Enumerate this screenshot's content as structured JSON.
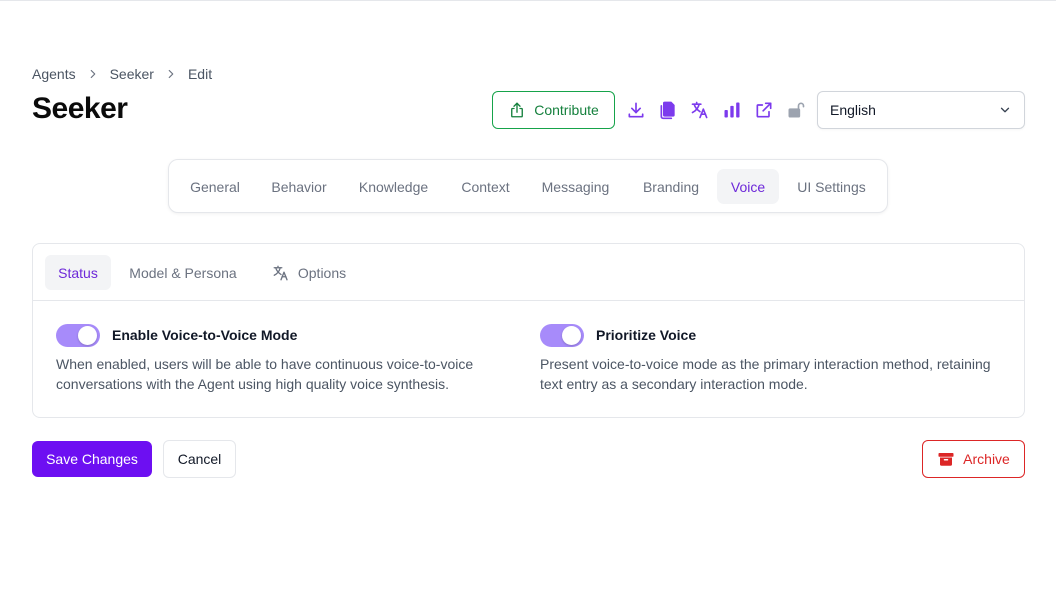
{
  "breadcrumb": [
    "Agents",
    "Seeker",
    "Edit"
  ],
  "page_title": "Seeker",
  "toolbar": {
    "contribute_label": "Contribute",
    "icons": [
      "download-icon",
      "copy-icon",
      "translate-icon",
      "bar-chart-icon",
      "external-link-icon",
      "unlock-icon"
    ],
    "language_selected": "English"
  },
  "main_tabs": [
    "General",
    "Behavior",
    "Knowledge",
    "Context",
    "Messaging",
    "Branding",
    "Voice",
    "UI Settings"
  ],
  "main_tabs_active": "Voice",
  "sub_tabs": [
    "Status",
    "Model & Persona",
    "Options"
  ],
  "sub_tabs_active": "Status",
  "settings": [
    {
      "title": "Enable Voice-to-Voice Mode",
      "description": "When enabled, users will be able to have continuous voice-to-voice conversations with the Agent using high quality voice synthesis.",
      "enabled": true
    },
    {
      "title": "Prioritize Voice",
      "description": "Present voice-to-voice mode as the primary interaction method, retaining text entry as a secondary interaction mode.",
      "enabled": true
    }
  ],
  "actions": {
    "save_label": "Save Changes",
    "cancel_label": "Cancel",
    "archive_label": "Archive"
  },
  "colors": {
    "accent": "#6d0ff2",
    "accent_text": "#6d28d9",
    "toggle_on": "#a78bfa",
    "contribute": "#16a34a",
    "danger": "#dc2626",
    "icon_purple": "#7c3aed"
  }
}
